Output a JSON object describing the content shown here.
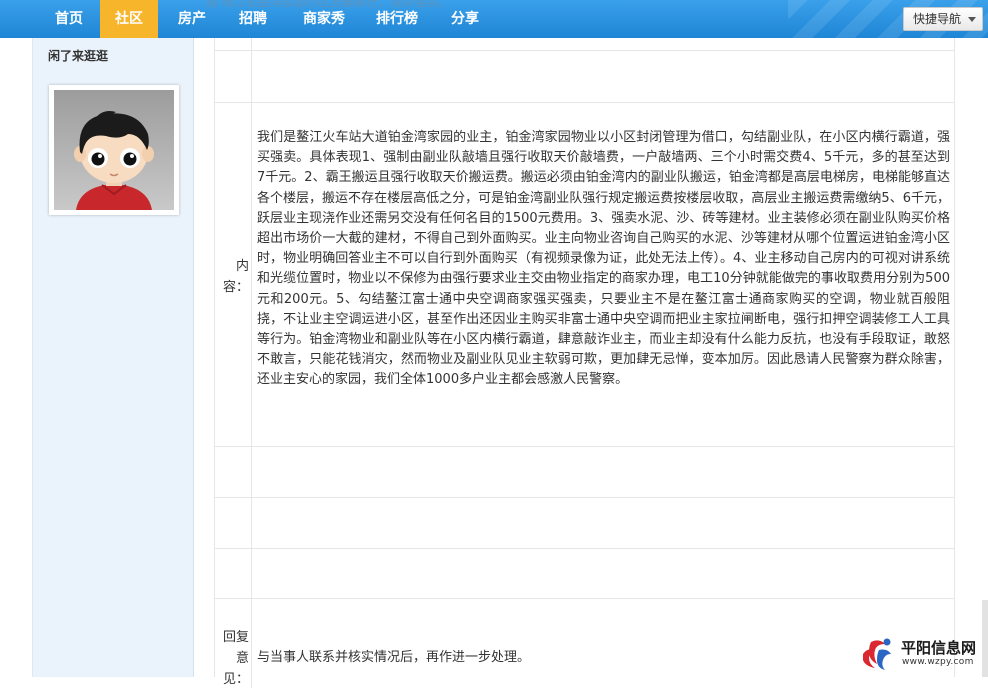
{
  "nav": {
    "items": [
      {
        "label": "首页"
      },
      {
        "label": "社区"
      },
      {
        "label": "房产"
      },
      {
        "label": "招聘"
      },
      {
        "label": "商家秀"
      },
      {
        "label": "排行榜"
      },
      {
        "label": "分享"
      }
    ],
    "active": "社区",
    "behind_text": "题  啸江铂金湾家园小区恶霸横行，强买强卖。",
    "quick_nav_label": "快捷导航"
  },
  "sidebar": {
    "title": "闲了来逛逛",
    "avatar_icon": "cartoon-boy-avatar"
  },
  "detail": {
    "content_label": "内容：",
    "content_label_lines": [
      "内",
      "容："
    ],
    "content": "我们是鳌江火车站大道铂金湾家园的业主，铂金湾家园物业以小区封闭管理为借口，勾结副业队，在小区内横行霸道，强买强卖。具体表现1、强制由副业队敲墙且强行收取天价敲墙费，一户敲墙两、三个小时需交费4、5千元，多的甚至达到7千元。2、霸王搬运且强行收取天价搬运费。搬运必须由铂金湾内的副业队搬运，铂金湾都是高层电梯房，电梯能够直达各个楼层，搬运不存在楼层高低之分，可是铂金湾副业队强行规定搬运费按楼层收取，高层业主搬运费需缴纳5、6千元，跃层业主现浇作业还需另交没有任何名目的1500元费用。3、强卖水泥、沙、砖等建材。业主装修必须在副业队购买价格超出市场价一大截的建材，不得自己到外面购买。业主向物业咨询自己购买的水泥、沙等建材从哪个位置运进铂金湾小区时，物业明确回答业主不可以自行到外面购买（有视频录像为证，此处无法上传）。4、业主移动自己房内的可视对讲系统和光缆位置时，物业以不保修为由强行要求业主交由物业指定的商家办理，电工10分钟就能做完的事收取费用分别为500元和200元。5、勾结鳌江富士通中央空调商家强买强卖，只要业主不是在鳌江富士通商家购买的空调，物业就百般阻挠，不让业主空调运进小区，甚至作出还因业主购买非富士通中央空调而把业主家拉闸断电，强行扣押空调装修工人工具等行为。铂金湾物业和副业队等在小区内横行霸道，肆意敲诈业主，而业主却没有什么能力反抗，也没有手段取证，敢怒不敢言，只能花钱消灾，然而物业及副业队见业主软弱可欺，更加肆无忌惮，变本加厉。因此恳请人民警察为群众除害，还业主安心的家园，我们全体1000多户业主都会感激人民警察。",
    "reply_label": "回复意见：",
    "reply_label_lines": [
      "回复",
      "意",
      "见："
    ],
    "reply": "与当事人联系并核实情况后，再作进一步处理。"
  },
  "watermark": {
    "name": "平阳信息网",
    "url": "www.wzpy.com",
    "icon": "site-logo-icon"
  },
  "colors": {
    "nav_bg": "#1f86d6",
    "nav_active": "#f7b52c",
    "sidebar_bg": "#eaf3fb",
    "logo_red": "#d9282f"
  }
}
